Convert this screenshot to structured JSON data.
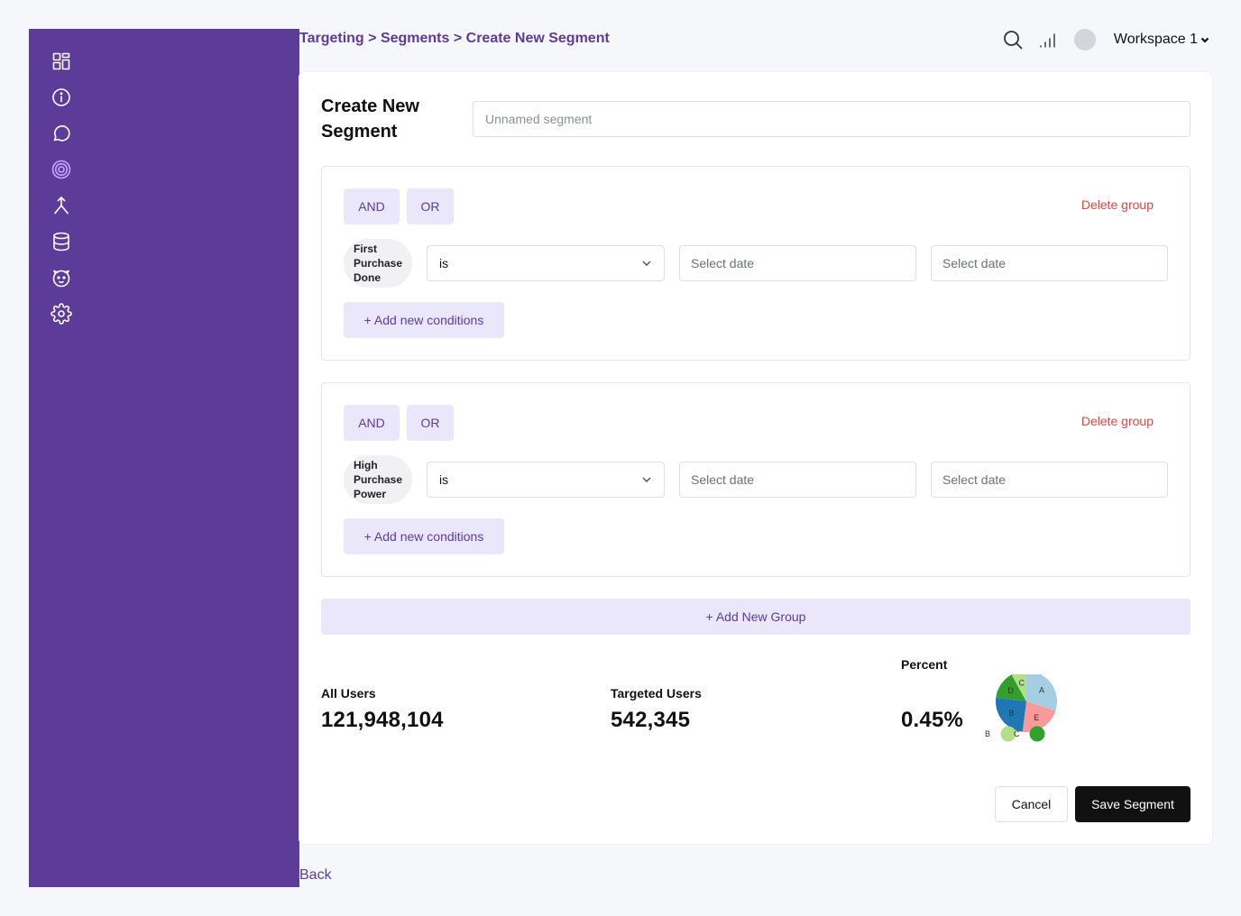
{
  "breadcrumb": {
    "item1": "Targeting",
    "sep1": " > ",
    "item2": "Segments",
    "sep2": " > ",
    "item3": "Create New Segment"
  },
  "topbar": {
    "search_icon": "search-icon",
    "signal_icon": "signal-icon",
    "workspace": "Workspace 1"
  },
  "sidebar": {
    "items": [
      {
        "icon": "dashboard-icon",
        "active": false
      },
      {
        "icon": "info-icon",
        "active": false
      },
      {
        "icon": "chat-icon",
        "active": false
      },
      {
        "icon": "target-icon",
        "active": true
      },
      {
        "icon": "split-icon",
        "active": false
      },
      {
        "icon": "database-icon",
        "active": false
      },
      {
        "icon": "mascot-icon",
        "active": false
      },
      {
        "icon": "gear-icon",
        "active": false
      }
    ],
    "active_color": "#c9a6ff",
    "background": "#5d3b98"
  },
  "form": {
    "title": "Create New Segment",
    "name_placeholder": "Unnamed segment",
    "name_value": ""
  },
  "groups": [
    {
      "and_label": "AND",
      "or_label": "OR",
      "delete_label": "Delete group",
      "attribute": "First Purchase Done",
      "operator": "is",
      "date_from_placeholder": "Select date",
      "date_to_placeholder": "Select date",
      "add_condition_label": "+ Add new conditions"
    },
    {
      "and_label": "AND",
      "or_label": "OR",
      "delete_label": "Delete group",
      "attribute": "High Purchase Power",
      "operator": "is",
      "date_from_placeholder": "Select date",
      "date_to_placeholder": "Select date",
      "add_condition_label": "+ Add new conditions"
    }
  ],
  "add_group_label": "+ Add New Group",
  "stats": {
    "all_users_label": "All Users",
    "all_users_value": "121,948,104",
    "targeted_label": "Targeted Users",
    "targeted_value": "542,345",
    "percent_label": "Percent",
    "percent_value": "0.45%"
  },
  "chart_data": {
    "type": "pie",
    "slices": [
      {
        "label": "A",
        "value": 30,
        "color": "#a6cee3"
      },
      {
        "label": "E",
        "value": 22,
        "color": "#fb9a99"
      },
      {
        "label": "B",
        "value": 25,
        "color": "#1f78b4"
      },
      {
        "label": "D",
        "value": 15,
        "color": "#33a02c"
      },
      {
        "label": "C",
        "value": 8,
        "color": "#b2df8a"
      }
    ],
    "legend": [
      {
        "label": "B",
        "color": "#b2df8a"
      },
      {
        "label": "C",
        "color": "#33a02c"
      }
    ]
  },
  "actions": {
    "cancel_label": "Cancel",
    "save_label": "Save Segment"
  },
  "back_label": "Back"
}
